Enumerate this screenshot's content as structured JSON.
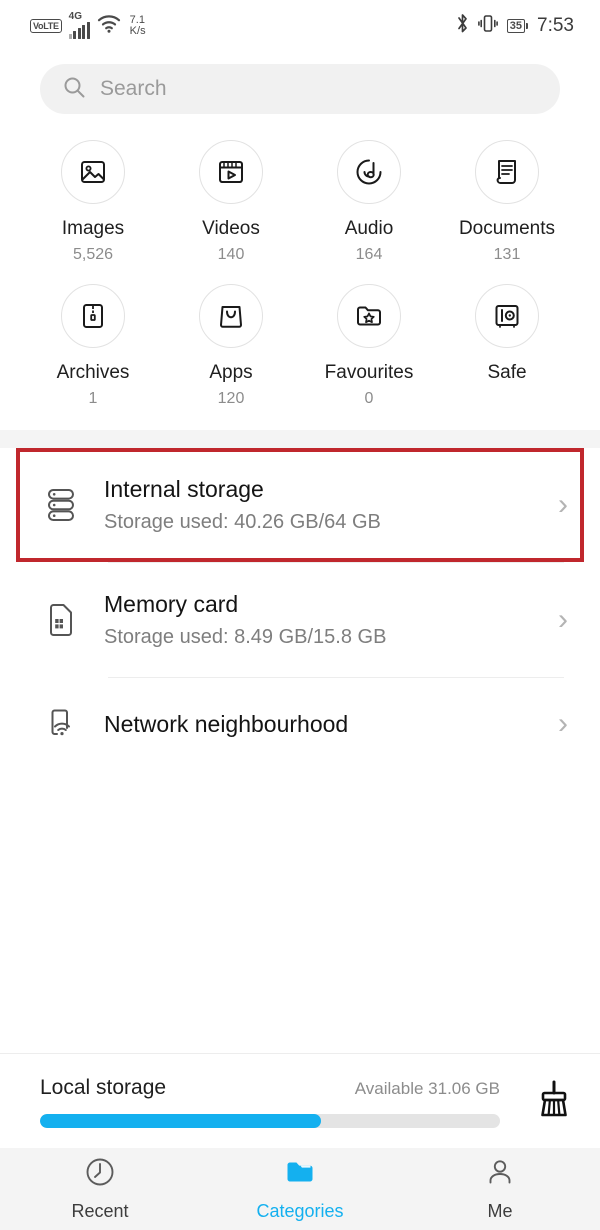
{
  "status_bar": {
    "volte": "VoLTE",
    "network_gen": "4G",
    "wifi_icon": "wifi-icon",
    "net_speed_value": "7.1",
    "net_speed_unit": "K/s",
    "bluetooth_icon": "bluetooth-icon",
    "vibrate_icon": "vibrate-icon",
    "battery_level": "35",
    "time": "7:53"
  },
  "search": {
    "placeholder": "Search",
    "value": "",
    "icon": "search-icon"
  },
  "categories": [
    {
      "name": "Images",
      "count": "5,526",
      "icon": "image-icon"
    },
    {
      "name": "Videos",
      "count": "140",
      "icon": "video-icon"
    },
    {
      "name": "Audio",
      "count": "164",
      "icon": "audio-icon"
    },
    {
      "name": "Documents",
      "count": "131",
      "icon": "document-icon"
    },
    {
      "name": "Archives",
      "count": "1",
      "icon": "archive-icon"
    },
    {
      "name": "Apps",
      "count": "120",
      "icon": "apps-icon"
    },
    {
      "name": "Favourites",
      "count": "0",
      "icon": "favourites-icon"
    },
    {
      "name": "Safe",
      "count": "",
      "icon": "safe-icon"
    }
  ],
  "storage_rows": {
    "internal": {
      "title": "Internal storage",
      "subtitle": "Storage used: 40.26 GB/64 GB",
      "icon": "internal-storage-icon",
      "chevron": "›",
      "highlighted": true,
      "highlight_color": "#c0272d"
    },
    "memory_card": {
      "title": "Memory card",
      "subtitle": "Storage used: 8.49 GB/15.8 GB",
      "icon": "sd-card-icon",
      "chevron": "›"
    },
    "network": {
      "title": "Network neighbourhood",
      "subtitle": "",
      "icon": "network-neighbourhood-icon",
      "chevron": "›"
    }
  },
  "local_storage": {
    "label": "Local storage",
    "available": "Available 31.06 GB",
    "used_percent": 61,
    "bar_color": "#14b0ef",
    "cleaner_icon": "broom-icon"
  },
  "bottom_nav": {
    "active_color": "#14b0ef",
    "items": [
      {
        "label": "Recent",
        "icon": "clock-icon",
        "active": false
      },
      {
        "label": "Categories",
        "icon": "folder-icon",
        "active": true
      },
      {
        "label": "Me",
        "icon": "person-icon",
        "active": false
      }
    ]
  }
}
